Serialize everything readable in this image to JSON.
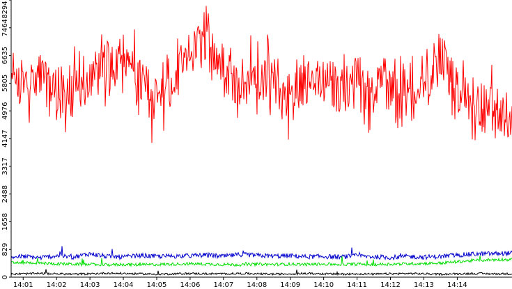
{
  "chart_data": {
    "type": "line",
    "title": "",
    "xlabel": "",
    "ylabel": "",
    "grid": false,
    "legend": "none",
    "ylim": [
      0,
      8294
    ],
    "xlim_minutes": [
      0.64,
      15.64
    ],
    "y_ticks": [
      0,
      829,
      1658,
      2488,
      3317,
      4147,
      4976,
      5805,
      6635,
      7464,
      8294
    ],
    "y_tick_labels": [
      "0",
      "829",
      "1658",
      "2488",
      "3317",
      "4147",
      "4976",
      "5805",
      "6635",
      "7464",
      "8294"
    ],
    "x_ticks": [
      "14:01",
      "14:02",
      "14:03",
      "14:04",
      "14:05",
      "14:06",
      "14:07",
      "14:08",
      "14:09",
      "14:10",
      "14:11",
      "14:12",
      "14:13",
      "14:14"
    ],
    "series": [
      {
        "color": "#ff0000",
        "x": [
          "14:00:39",
          "14:01:00",
          "14:01:30",
          "14:02:00",
          "14:02:30",
          "14:03:00",
          "14:03:30",
          "14:04:00",
          "14:04:30",
          "14:05:00",
          "14:05:30",
          "14:06:00",
          "14:06:30",
          "14:07:00",
          "14:07:30",
          "14:08:00",
          "14:08:30",
          "14:09:00",
          "14:09:30",
          "14:10:00",
          "14:10:30",
          "14:11:00",
          "14:11:30",
          "14:12:00",
          "14:12:30",
          "14:13:00",
          "14:13:30",
          "14:14:00",
          "14:14:30",
          "14:15:00",
          "14:15:38"
        ],
        "values": [
          5650,
          5800,
          6000,
          5600,
          5500,
          5900,
          6400,
          6800,
          5800,
          5300,
          5700,
          6700,
          7000,
          6300,
          5800,
          6100,
          5700,
          5500,
          5800,
          5900,
          5600,
          5800,
          5700,
          5900,
          5500,
          5600,
          6700,
          5600,
          5200,
          5000,
          4900
        ]
      },
      {
        "color": "#0000cc",
        "x": [
          "14:00:39",
          "14:01:00",
          "14:01:30",
          "14:02:00",
          "14:02:30",
          "14:03:00",
          "14:03:30",
          "14:04:00",
          "14:04:30",
          "14:05:00",
          "14:05:30",
          "14:06:00",
          "14:06:30",
          "14:07:00",
          "14:07:30",
          "14:08:00",
          "14:08:30",
          "14:09:00",
          "14:09:30",
          "14:10:00",
          "14:10:30",
          "14:11:00",
          "14:11:30",
          "14:12:00",
          "14:12:30",
          "14:13:00",
          "14:13:30",
          "14:14:00",
          "14:14:30",
          "14:15:00",
          "14:15:38"
        ],
        "values": [
          600,
          620,
          580,
          640,
          600,
          700,
          620,
          600,
          650,
          620,
          630,
          640,
          660,
          620,
          680,
          650,
          630,
          640,
          610,
          620,
          600,
          640,
          610,
          590,
          620,
          600,
          620,
          660,
          690,
          700,
          720
        ]
      },
      {
        "color": "#00dd00",
        "x": [
          "14:00:39",
          "14:01:00",
          "14:01:30",
          "14:02:00",
          "14:02:30",
          "14:03:00",
          "14:03:30",
          "14:04:00",
          "14:04:30",
          "14:05:00",
          "14:05:30",
          "14:06:00",
          "14:06:30",
          "14:07:00",
          "14:07:30",
          "14:08:00",
          "14:08:30",
          "14:09:00",
          "14:09:30",
          "14:10:00",
          "14:10:30",
          "14:11:00",
          "14:11:30",
          "14:12:00",
          "14:12:30",
          "14:13:00",
          "14:13:30",
          "14:14:00",
          "14:14:30",
          "14:15:00",
          "14:15:38"
        ],
        "values": [
          430,
          440,
          420,
          400,
          390,
          380,
          370,
          380,
          370,
          380,
          390,
          400,
          390,
          380,
          370,
          390,
          380,
          390,
          380,
          390,
          380,
          390,
          380,
          390,
          400,
          410,
          420,
          460,
          500,
          520,
          530
        ]
      },
      {
        "color": "#000000",
        "x": [
          "14:00:39",
          "14:01:00",
          "14:01:30",
          "14:02:00",
          "14:02:30",
          "14:03:00",
          "14:03:30",
          "14:04:00",
          "14:04:30",
          "14:05:00",
          "14:05:30",
          "14:06:00",
          "14:06:30",
          "14:07:00",
          "14:07:30",
          "14:08:00",
          "14:08:30",
          "14:09:00",
          "14:09:30",
          "14:10:00",
          "14:10:30",
          "14:11:00",
          "14:11:30",
          "14:12:00",
          "14:12:30",
          "14:13:00",
          "14:13:30",
          "14:14:00",
          "14:14:30",
          "14:15:00",
          "14:15:38"
        ],
        "values": [
          90,
          100,
          110,
          100,
          90,
          100,
          120,
          110,
          100,
          90,
          100,
          110,
          100,
          100,
          110,
          100,
          90,
          100,
          110,
          100,
          90,
          100,
          90,
          100,
          110,
          100,
          90,
          100,
          110,
          100,
          100
        ]
      }
    ]
  }
}
